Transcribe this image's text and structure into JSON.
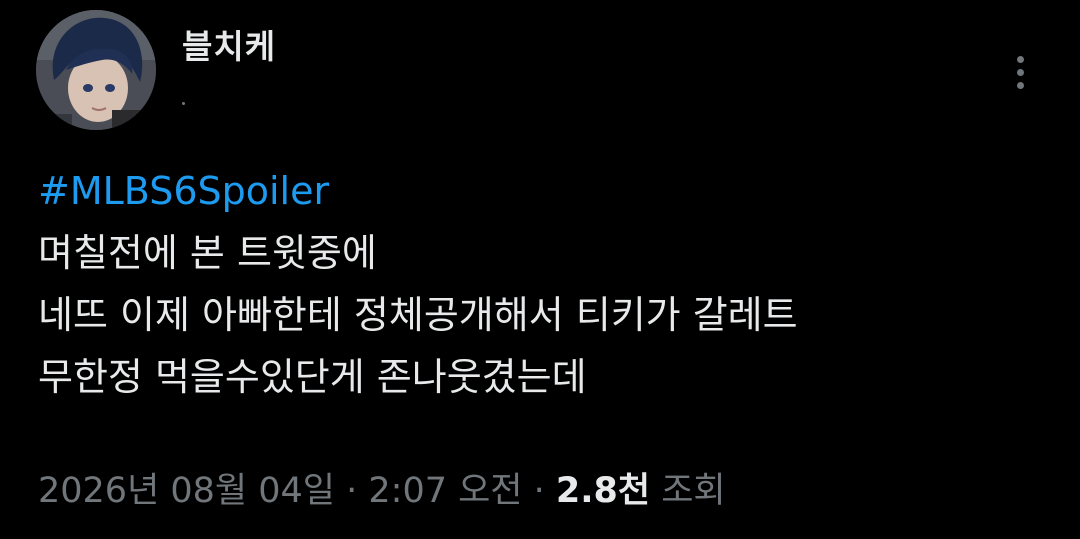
{
  "author": {
    "display_name": "블치케"
  },
  "tweet": {
    "hashtag": "#MLBS6Spoiler",
    "lines": [
      "며칠전에 본 트윗중에",
      "네뜨 이제 아빠한테 정체공개해서 티키가 갈레트",
      "무한정 먹을수있단게 존나웃겼는데"
    ]
  },
  "meta": {
    "date": "2026년 08월 04일",
    "separator_1": " · ",
    "time": "2:07 오전",
    "separator_2": " · ",
    "views_count": "2.8천",
    "views_label": " 조회"
  },
  "colors": {
    "background": "#000000",
    "text": "#e7e9ea",
    "secondary": "#71767b",
    "link": "#1d9bf0"
  },
  "icons": {
    "more": "more-vertical-icon"
  }
}
